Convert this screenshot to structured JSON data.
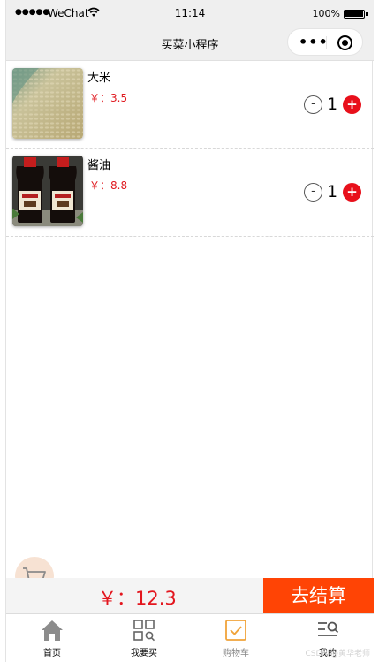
{
  "status_bar": {
    "signal": "●●●●●",
    "carrier": "WeChat",
    "time": "11:14",
    "battery": "100%"
  },
  "navbar": {
    "title": "买菜小程序",
    "more_glyph": "•••"
  },
  "items": [
    {
      "name": "大米",
      "price": "￥：3.5",
      "quantity": "1",
      "image": "rice-photo"
    },
    {
      "name": "酱油",
      "price": "￥：8.8",
      "quantity": "1",
      "image": "soy-sauce-photo"
    }
  ],
  "stepper": {
    "minus": "-",
    "plus": "+"
  },
  "checkout": {
    "total": "￥：12.3",
    "pay_label": "去结算"
  },
  "tabs": [
    {
      "label": "首页",
      "icon": "home-icon"
    },
    {
      "label": "我要买",
      "icon": "grid-search-icon"
    },
    {
      "label": "购物车",
      "icon": "checkbox-icon",
      "active": true
    },
    {
      "label": "我的",
      "icon": "menu-search-icon"
    }
  ],
  "watermark": "CSDN @黄华老师",
  "colors": {
    "price_red": "#e0191f",
    "plus_red": "#e8101b",
    "pay_orange": "#ff4405",
    "cart_tab_orange": "#f0a33a"
  }
}
